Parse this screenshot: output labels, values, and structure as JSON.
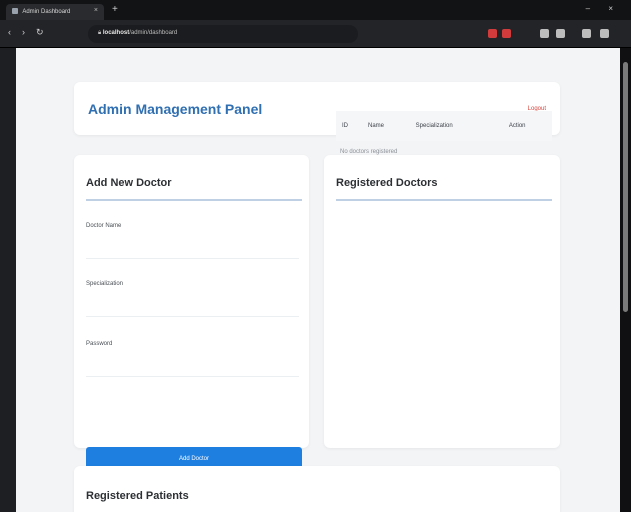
{
  "browser": {
    "tab_title": "Admin Dashboard",
    "tab_close_glyph": "×",
    "new_tab_glyph": "+",
    "window_controls": "–  ×",
    "nav_back": "‹",
    "nav_forward": "›",
    "nav_reload": "↻",
    "url_host": "localhost",
    "url_rest": "/admin/dashboard"
  },
  "header": {
    "brand": "Admin Management Panel",
    "logout_label": "Logout"
  },
  "add_doctor": {
    "title": "Add New Doctor",
    "fields": [
      {
        "label": "Doctor Name",
        "value": "",
        "placeholder": ""
      },
      {
        "label": "Specialization",
        "value": "",
        "placeholder": ""
      },
      {
        "label": "Password",
        "value": "",
        "placeholder": ""
      }
    ],
    "submit_label": "Add Doctor"
  },
  "registered_doctors": {
    "title": "Registered Doctors",
    "columns": [
      "ID",
      "Name",
      "Specialization",
      "Action"
    ],
    "empty_text": "No doctors registered"
  },
  "registered_patients": {
    "title": "Registered Patients"
  },
  "colors": {
    "accent": "#1f7fe0",
    "brand": "#2f6fb2",
    "danger": "#d6453d",
    "page_bg": "#f3f4f6"
  },
  "icons": [
    "favicon-icon",
    "close-icon",
    "plus-icon",
    "back-icon",
    "forward-icon",
    "reload-icon",
    "lock-icon",
    "extension-icon"
  ]
}
